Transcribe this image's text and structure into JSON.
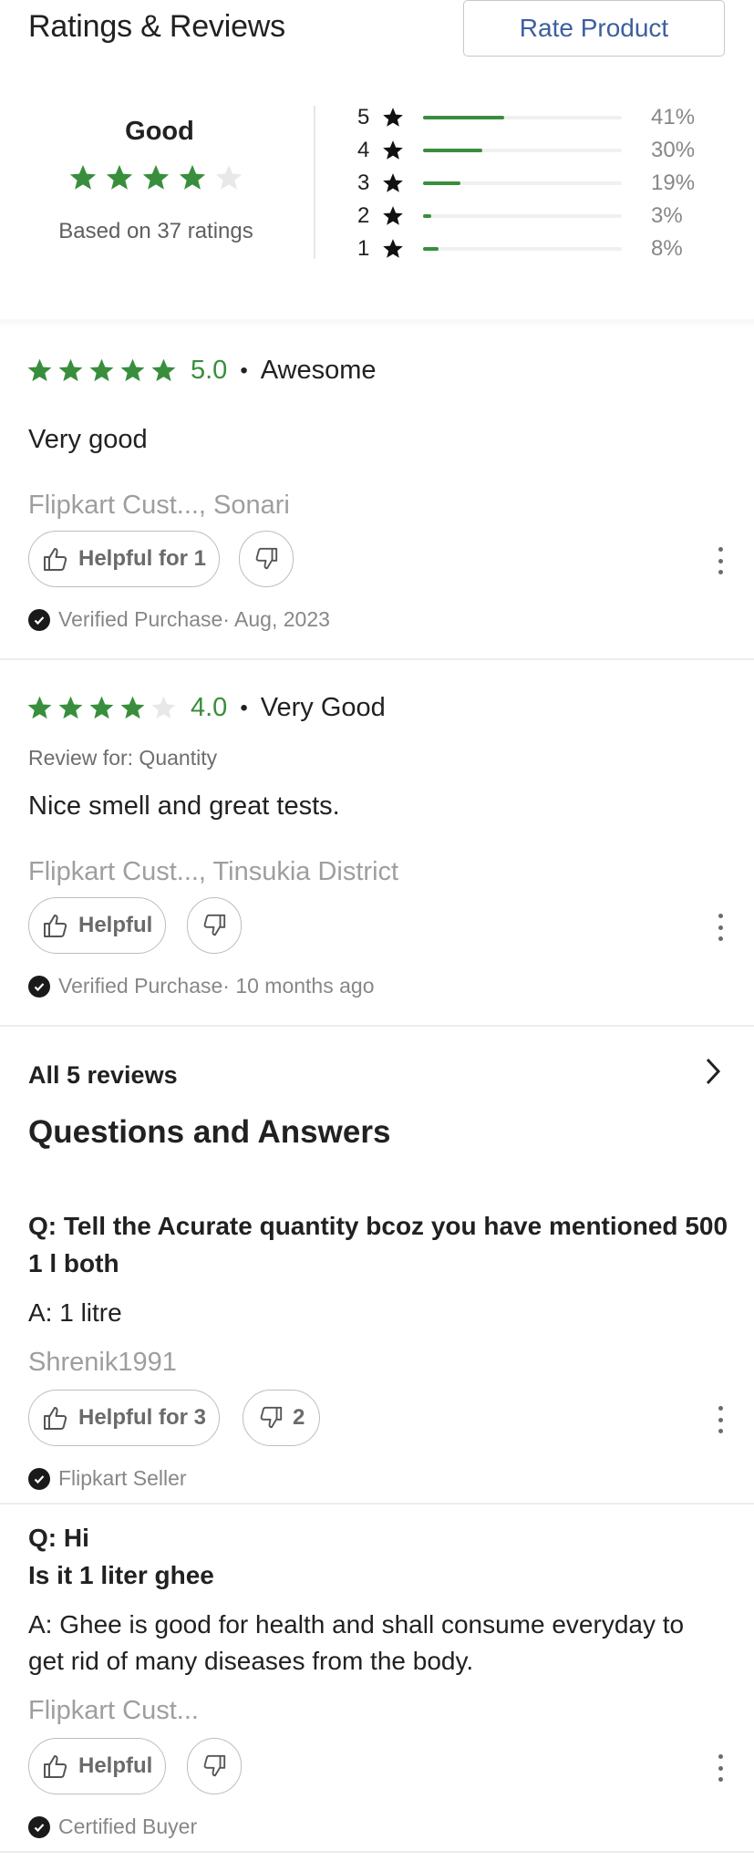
{
  "header": {
    "title": "Ratings & Reviews",
    "rate_button": "Rate Product"
  },
  "summary": {
    "label": "Good",
    "stars_filled": 4,
    "stars_total": 5,
    "based_on": "Based on 37 ratings",
    "distribution": [
      {
        "stars": "5",
        "percent_text": "41%",
        "fill": 0.41
      },
      {
        "stars": "4",
        "percent_text": "30%",
        "fill": 0.3
      },
      {
        "stars": "3",
        "percent_text": "19%",
        "fill": 0.19
      },
      {
        "stars": "2",
        "percent_text": "3%",
        "fill": 0.03
      },
      {
        "stars": "1",
        "percent_text": "8%",
        "fill": 0.08
      }
    ]
  },
  "reviews": [
    {
      "stars_filled": 5,
      "score": "5.0",
      "dot": "•",
      "title": "Awesome",
      "review_for": "",
      "text": "Very good",
      "author": "Flipkart Cust..., Sonari",
      "helpful_label": "Helpful for 1",
      "verified": "Verified Purchase· Aug, 2023"
    },
    {
      "stars_filled": 4,
      "score": "4.0",
      "dot": "•",
      "title": "Very Good",
      "review_for": "Review for: Quantity",
      "text": "Nice smell and  great tests.",
      "author": "Flipkart Cust..., Tinsukia District",
      "helpful_label": "Helpful",
      "verified": "Verified Purchase· 10 months ago"
    }
  ],
  "all_reviews": "All 5 reviews",
  "qa": {
    "title": "Questions and Answers",
    "items": [
      {
        "q1": "Q: Tell the Acurate quantity bcoz you have mentioned 500",
        "q2": "1 l both",
        "a1": "A: 1 litre",
        "a2": "",
        "author": "Shrenik1991",
        "helpful_label": "Helpful for 3",
        "dislike_count": "2",
        "badge": "Flipkart Seller"
      },
      {
        "q1": "Q: Hi",
        "q2": "Is it 1 liter ghee",
        "a1": "A: Ghee is good for health and shall consume everyday to",
        "a2": "get rid of many diseases from the body.",
        "author": "Flipkart Cust...",
        "helpful_label": "Helpful",
        "dislike_count": "",
        "badge": "Certified Buyer"
      }
    ]
  },
  "colors": {
    "star_green": "#388e3c",
    "star_empty": "#e8e8e8",
    "bar_track": "#f0f0f0",
    "link_blue": "#3d5f9f"
  }
}
